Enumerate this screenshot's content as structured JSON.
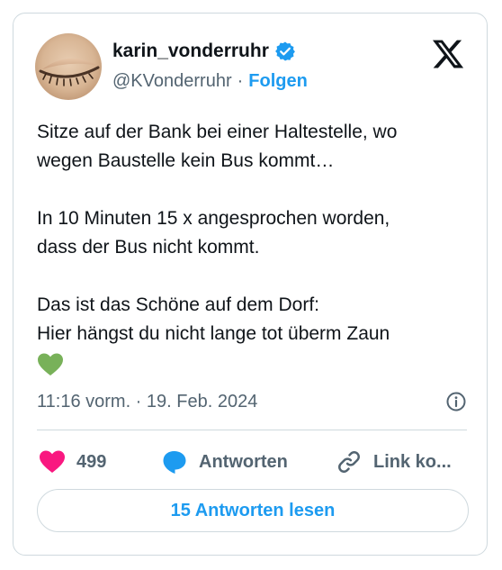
{
  "tweet": {
    "author": {
      "name": "karin_vonderruhr",
      "handle": "@KVonderruhr",
      "verified": true,
      "separator": "·",
      "follow_label": "Folgen"
    },
    "text_lines": [
      "Sitze auf der Bank bei einer Haltestelle, wo",
      "wegen Baustelle kein Bus kommt…",
      "In 10 Minuten 15 x angesprochen worden,",
      "dass der Bus nicht kommt.",
      "Das ist das Schöne auf dem Dorf:",
      "Hier hängst du nicht lange tot überm Zaun"
    ],
    "emoji": "green-heart",
    "timestamp": "11:16 vorm. · 19. Feb. 2024",
    "actions": {
      "like_count": "499",
      "reply_label": "Antworten",
      "link_label": "Link ko..."
    },
    "read_replies_label": "15 Antworten lesen"
  },
  "icons": {
    "verified": "verified-badge-icon",
    "logo": "x-logo-icon",
    "info": "info-icon",
    "like": "heart-icon",
    "reply": "reply-bubble-icon",
    "link": "link-icon"
  },
  "colors": {
    "accent": "#1d9bf0",
    "like": "#f91880",
    "text": "#0f1419",
    "secondary": "#536471",
    "border": "#cfd9de",
    "emoji_heart": "#78b159"
  }
}
